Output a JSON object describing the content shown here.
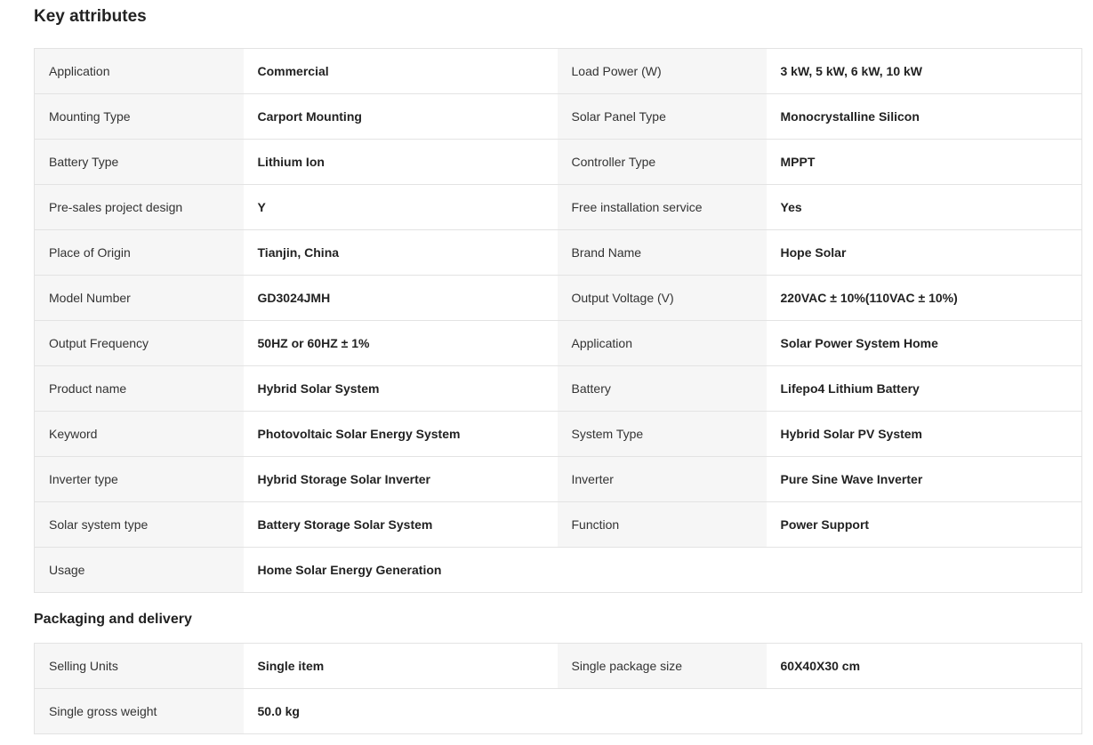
{
  "key_attributes": {
    "title": "Key attributes",
    "rows": [
      [
        {
          "k": "Application",
          "v": "Commercial"
        },
        {
          "k": "Load Power (W)",
          "v": "3 kW, 5 kW, 6 kW, 10 kW"
        }
      ],
      [
        {
          "k": "Mounting Type",
          "v": "Carport Mounting"
        },
        {
          "k": "Solar Panel Type",
          "v": "Monocrystalline Silicon"
        }
      ],
      [
        {
          "k": "Battery Type",
          "v": "Lithium Ion"
        },
        {
          "k": "Controller Type",
          "v": "MPPT"
        }
      ],
      [
        {
          "k": "Pre-sales project design",
          "v": "Y"
        },
        {
          "k": "Free installation service",
          "v": "Yes"
        }
      ],
      [
        {
          "k": "Place of Origin",
          "v": "Tianjin, China"
        },
        {
          "k": "Brand Name",
          "v": "Hope Solar"
        }
      ],
      [
        {
          "k": "Model Number",
          "v": "GD3024JMH"
        },
        {
          "k": "Output Voltage (V)",
          "v": "220VAC ± 10%(110VAC ± 10%)"
        }
      ],
      [
        {
          "k": "Output Frequency",
          "v": "50HZ or 60HZ ± 1%"
        },
        {
          "k": "Application",
          "v": "Solar Power System Home"
        }
      ],
      [
        {
          "k": "Product name",
          "v": "Hybrid Solar System"
        },
        {
          "k": "Battery",
          "v": "Lifepo4 Lithium Battery"
        }
      ],
      [
        {
          "k": "Keyword",
          "v": "Photovoltaic Solar Energy System"
        },
        {
          "k": "System Type",
          "v": "Hybrid Solar PV System"
        }
      ],
      [
        {
          "k": "Inverter type",
          "v": "Hybrid Storage Solar Inverter"
        },
        {
          "k": "Inverter",
          "v": "Pure Sine Wave Inverter"
        }
      ],
      [
        {
          "k": "Solar system type",
          "v": "Battery Storage Solar System"
        },
        {
          "k": "Function",
          "v": "Power Support"
        }
      ],
      [
        {
          "k": "Usage",
          "v": "Home Solar Energy Generation"
        },
        null
      ]
    ]
  },
  "packaging": {
    "title": "Packaging and delivery",
    "rows": [
      [
        {
          "k": "Selling Units",
          "v": "Single item"
        },
        {
          "k": "Single package size",
          "v": "60X40X30 cm"
        }
      ],
      [
        {
          "k": "Single gross weight",
          "v": "50.0 kg"
        },
        null
      ]
    ]
  }
}
